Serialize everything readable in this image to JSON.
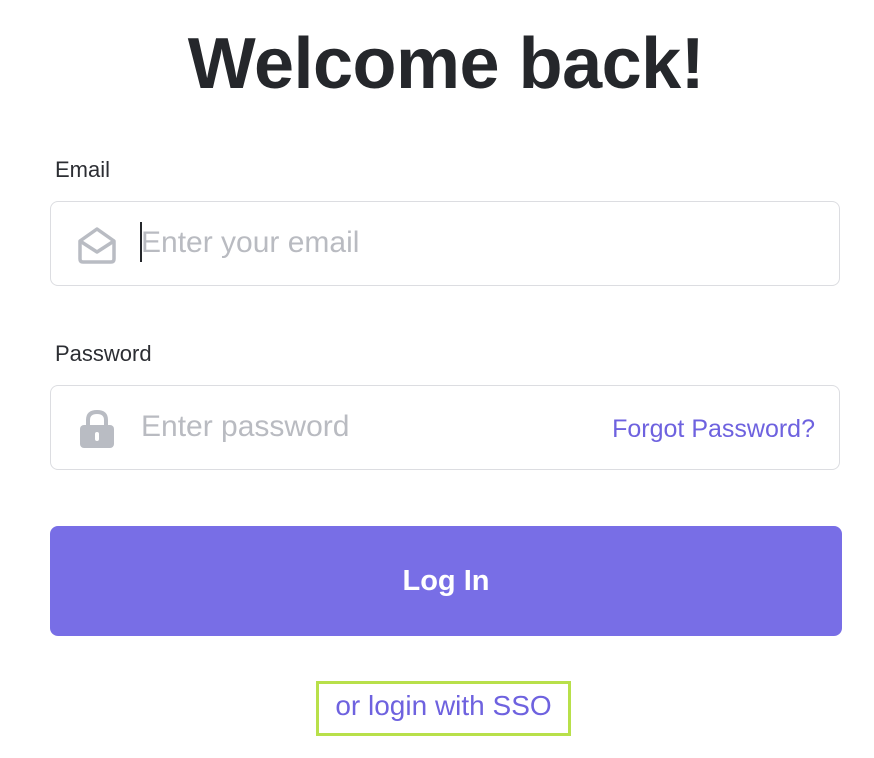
{
  "header": {
    "title": "Welcome back!"
  },
  "email": {
    "label": "Email",
    "placeholder": "Enter your email",
    "value": "",
    "icon": "envelope-open-icon"
  },
  "password": {
    "label": "Password",
    "placeholder": "Enter password",
    "value": "",
    "icon": "lock-icon",
    "forgot_label": "Forgot Password?"
  },
  "actions": {
    "login_label": "Log In",
    "sso_label": "or login with SSO"
  },
  "colors": {
    "accent": "#786ee6",
    "link": "#6e62df",
    "highlight": "#b8e04a",
    "text": "#25272b",
    "placeholder": "#b9bbc1",
    "border": "#dcdde1"
  }
}
